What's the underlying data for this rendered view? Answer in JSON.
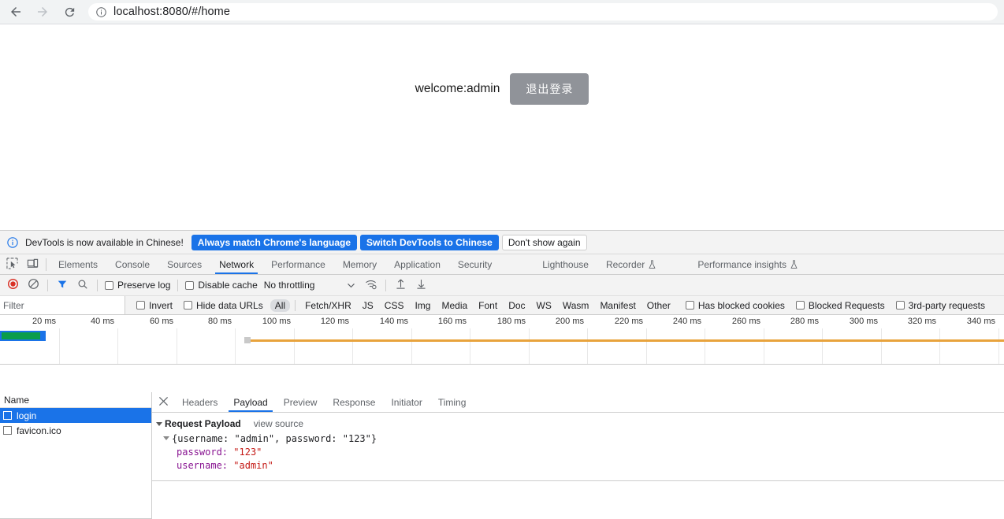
{
  "browser": {
    "back_icon": "arrow-left-icon",
    "forward_icon": "arrow-right-icon",
    "reload_icon": "reload-icon",
    "site_info_icon": "info-circle-icon",
    "url": "localhost:8080/#/home"
  },
  "page": {
    "welcome_text": "welcome:admin",
    "logout_label": "退出登录",
    "logout_bg": "#909399"
  },
  "devtools": {
    "infobar": {
      "icon": "info-circle-icon",
      "message": "DevTools is now available in Chinese!",
      "primary_buttons": [
        "Always match Chrome's language",
        "Switch DevTools to Chinese"
      ],
      "secondary_button": "Don't show again",
      "accent": "#1a73e8"
    },
    "tabs": [
      {
        "label": "Elements",
        "active": false,
        "flask": false
      },
      {
        "label": "Console",
        "active": false,
        "flask": false
      },
      {
        "label": "Sources",
        "active": false,
        "flask": false
      },
      {
        "label": "Network",
        "active": true,
        "flask": false
      },
      {
        "label": "Performance",
        "active": false,
        "flask": false
      },
      {
        "label": "Memory",
        "active": false,
        "flask": false
      },
      {
        "label": "Application",
        "active": false,
        "flask": false
      },
      {
        "label": "Security",
        "active": false,
        "flask": false
      },
      {
        "label": "Lighthouse",
        "active": false,
        "flask": false
      },
      {
        "label": "Recorder",
        "active": false,
        "flask": true
      },
      {
        "label": "Performance insights",
        "active": false,
        "flask": true
      }
    ],
    "tab_icons": {
      "inspect": "inspect-element-icon",
      "device": "device-toolbar-icon"
    },
    "network_toolbar": {
      "record_icon": "record-stop-icon",
      "clear_icon": "clear-network-icon",
      "filter_icon": "funnel-filter-icon",
      "search_icon": "search-icon",
      "preserve_log_label": "Preserve log",
      "preserve_log_checked": false,
      "disable_cache_label": "Disable cache",
      "disable_cache_checked": false,
      "throttling_value": "No throttling",
      "throttling_caret_icon": "chevron-down-icon",
      "wifi_icon": "network-conditions-icon",
      "import_icon": "import-har-icon",
      "export_icon": "export-har-icon"
    },
    "filter_bar": {
      "filter_placeholder": "Filter",
      "filter_value": "",
      "invert_label": "Invert",
      "invert_checked": false,
      "hide_data_urls_label": "Hide data URLs",
      "hide_data_urls_checked": false,
      "types": [
        {
          "label": "All",
          "selected": true
        },
        {
          "label": "Fetch/XHR",
          "selected": false
        },
        {
          "label": "JS",
          "selected": false
        },
        {
          "label": "CSS",
          "selected": false
        },
        {
          "label": "Img",
          "selected": false
        },
        {
          "label": "Media",
          "selected": false
        },
        {
          "label": "Font",
          "selected": false
        },
        {
          "label": "Doc",
          "selected": false
        },
        {
          "label": "WS",
          "selected": false
        },
        {
          "label": "Wasm",
          "selected": false
        },
        {
          "label": "Manifest",
          "selected": false
        },
        {
          "label": "Other",
          "selected": false
        }
      ],
      "has_blocked_cookies_label": "Has blocked cookies",
      "has_blocked_cookies_checked": false,
      "blocked_requests_label": "Blocked Requests",
      "blocked_requests_checked": false,
      "third_party_label": "3rd-party requests",
      "third_party_checked": false
    },
    "overview": {
      "tick_labels": [
        "20 ms",
        "40 ms",
        "60 ms",
        "80 ms",
        "100 ms",
        "120 ms",
        "140 ms",
        "160 ms",
        "180 ms",
        "200 ms",
        "220 ms",
        "240 ms",
        "260 ms",
        "280 ms",
        "300 ms",
        "320 ms",
        "340 ms"
      ],
      "band_color": "#1a73e8",
      "band_inner_color": "#0a9d4b",
      "line_color": "#e8a33d"
    },
    "request_list": {
      "column_header": "Name",
      "rows": [
        {
          "name": "login",
          "selected": true
        },
        {
          "name": "favicon.ico",
          "selected": false
        }
      ]
    },
    "detail": {
      "close_icon": "close-icon",
      "tabs": [
        {
          "label": "Headers",
          "active": false
        },
        {
          "label": "Payload",
          "active": true
        },
        {
          "label": "Preview",
          "active": false
        },
        {
          "label": "Response",
          "active": false
        },
        {
          "label": "Initiator",
          "active": false
        },
        {
          "label": "Timing",
          "active": false
        }
      ],
      "payload": {
        "section_title": "Request Payload",
        "view_source_label": "view source",
        "object_summary": "{username: \"admin\", password: \"123\"}",
        "properties": [
          {
            "key": "password:",
            "value": "\"123\""
          },
          {
            "key": "username:",
            "value": "\"admin\""
          }
        ]
      }
    }
  }
}
